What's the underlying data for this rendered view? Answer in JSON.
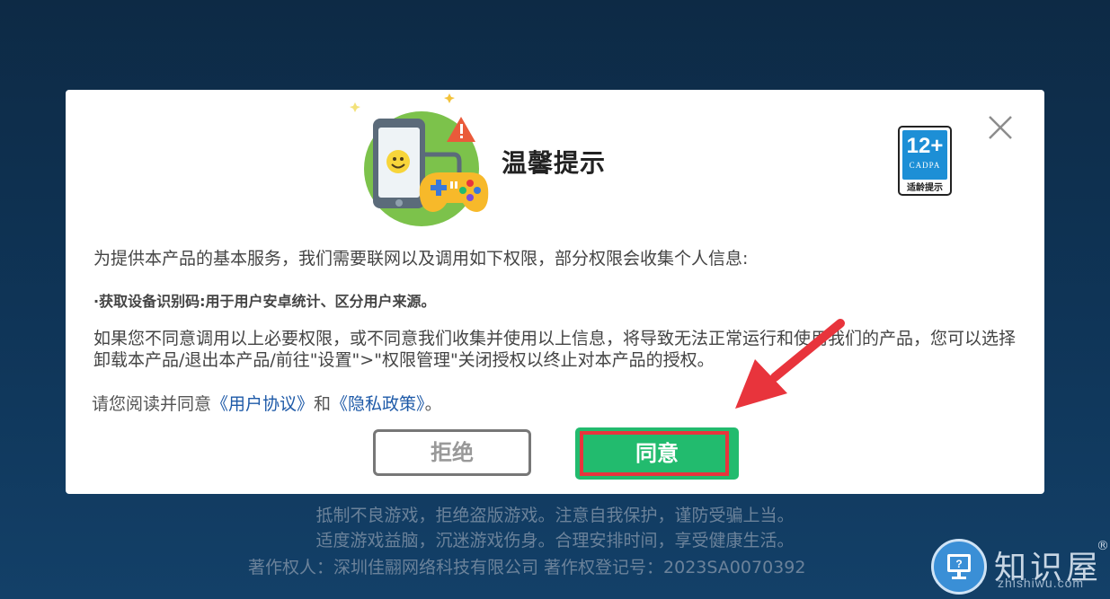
{
  "dialog": {
    "title": "温馨提示",
    "rating": {
      "age": "12+",
      "org": "CADPA",
      "note": "适龄提示"
    },
    "close_icon": "close-icon",
    "intro": "为提供本产品的基本服务，我们需要联网以及调用如下权限，部分权限会收集个人信息:",
    "permission": "·获取设备识别码:用于用户安卓统计、区分用户来源。",
    "disclaimer": "如果您不同意调用以上必要权限，或不同意我们收集并使用以上信息，将导致无法正常运行和使用我们的产品，您可以选择卸载本产品/退出本产品/前往\"设置\">\"权限管理\"关闭授权以终止对本产品的授权。",
    "consent": {
      "prefix": "请您阅读并同意",
      "user_agreement": "《用户协议》",
      "and": "和",
      "privacy_policy": "《隐私政策》",
      "suffix": "。"
    },
    "refuse_label": "拒绝",
    "agree_label": "同意"
  },
  "footer": {
    "line1": "抵制不良游戏，拒绝盗版游戏。注意自我保护，谨防受骗上当。",
    "line2": "适度游戏益脑，沉迷游戏伤身。合理安排时间，享受健康生活。",
    "line3": "著作权人：深圳佳翮网络科技有限公司   著作权登记号：2023SA0070392"
  },
  "watermark": {
    "text": "知识屋",
    "sub": "zhishiwu.com",
    "reg": "®"
  },
  "colors": {
    "agree": "#22bb6e",
    "highlight": "#e8343c",
    "link": "#1e5aa8",
    "rating_blue": "#1d8fd6"
  }
}
